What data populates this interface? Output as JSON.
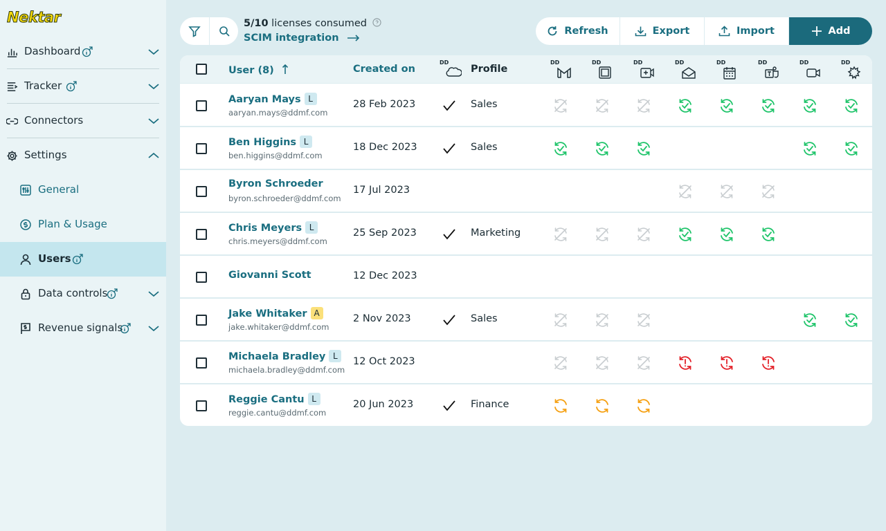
{
  "app": {
    "logo_text": "Nektar"
  },
  "sidebar": {
    "items": [
      {
        "label": "Dashboard"
      },
      {
        "label": "Tracker"
      },
      {
        "label": "Connectors"
      },
      {
        "label": "Settings"
      }
    ],
    "settings_sub": [
      {
        "label": "General"
      },
      {
        "label": "Plan & Usage"
      },
      {
        "label": "Users"
      },
      {
        "label": "Data controls"
      },
      {
        "label": "Revenue signals"
      }
    ],
    "active_item": "Users"
  },
  "toolbar": {
    "licenses_count": "5/10",
    "licenses_text": " licenses consumed",
    "scim_label": "SCIM integration",
    "refresh_label": "Refresh",
    "export_label": "Export",
    "import_label": "Import",
    "add_label": "Add"
  },
  "table": {
    "col_user": "User (8)",
    "col_created": "Created on",
    "col_profile": "Profile",
    "dd_label": "DD",
    "integration_icons": [
      "salesforce-icon",
      "gmail-icon",
      "office-icon",
      "zoom-icon",
      "email-icon",
      "calendar-icon",
      "teams-icon",
      "video-icon",
      "gong-icon"
    ],
    "rows": [
      {
        "name": "Aaryan Mays",
        "badge": "L",
        "email": "aaryan.mays@ddmf.com",
        "created": "28 Feb 2023",
        "crm": true,
        "profile": "Sales",
        "status": [
          "",
          "off",
          "off",
          "off",
          "ok",
          "ok",
          "ok",
          "ok",
          "ok"
        ]
      },
      {
        "name": "Ben Higgins",
        "badge": "L",
        "email": "ben.higgins@ddmf.com",
        "created": "18 Dec 2023",
        "crm": true,
        "profile": "Sales",
        "status": [
          "",
          "ok",
          "ok",
          "ok",
          "",
          "",
          "",
          "ok",
          "ok"
        ]
      },
      {
        "name": "Byron Schroeder",
        "badge": "",
        "email": "byron.schroeder@ddmf.com",
        "created": "17 Jul 2023",
        "crm": false,
        "profile": "",
        "status": [
          "",
          "",
          "",
          "",
          "off",
          "off",
          "off",
          "",
          ""
        ]
      },
      {
        "name": "Chris Meyers",
        "badge": "L",
        "email": "chris.meyers@ddmf.com",
        "created": "25 Sep 2023",
        "crm": true,
        "profile": "Marketing",
        "status": [
          "",
          "off",
          "off",
          "off",
          "ok",
          "ok",
          "ok",
          "",
          ""
        ]
      },
      {
        "name": "Giovanni Scott",
        "badge": "",
        "email": "",
        "created": "12 Dec 2023",
        "crm": false,
        "profile": "",
        "status": [
          "",
          "",
          "",
          "",
          "",
          "",
          "",
          "",
          ""
        ]
      },
      {
        "name": "Jake Whitaker",
        "badge": "A",
        "email": "jake.whitaker@ddmf.com",
        "created": "2 Nov 2023",
        "crm": true,
        "profile": "Sales",
        "status": [
          "",
          "off",
          "off",
          "off",
          "",
          "",
          "",
          "ok",
          "ok"
        ]
      },
      {
        "name": "Michaela Bradley",
        "badge": "L",
        "email": "michaela.bradley@ddmf.com",
        "created": "12 Oct 2023",
        "crm": false,
        "profile": "",
        "status": [
          "",
          "off",
          "off",
          "off",
          "err",
          "err",
          "err",
          "",
          ""
        ]
      },
      {
        "name": "Reggie Cantu",
        "badge": "L",
        "email": "reggie.cantu@ddmf.com",
        "created": "20 Jun 2023",
        "crm": true,
        "profile": "Finance",
        "status": [
          "",
          "sync",
          "sync",
          "sync",
          "",
          "",
          "",
          "",
          ""
        ]
      }
    ]
  },
  "colors": {
    "accent": "#1a6e80",
    "ok": "#1fc46a",
    "error": "#e3222a",
    "sync": "#f5a012",
    "off": "#c8cdd0"
  }
}
